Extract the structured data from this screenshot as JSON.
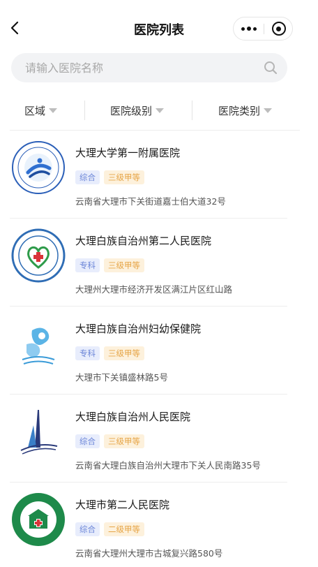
{
  "header": {
    "title": "医院列表",
    "back_icon": "chevron-left-icon",
    "more_icon": "more-dots-icon",
    "close_icon": "target-close-icon"
  },
  "search": {
    "placeholder": "请输入医院名称",
    "value": "",
    "icon": "search-icon"
  },
  "filters": [
    {
      "label": "区域"
    },
    {
      "label": "医院级别"
    },
    {
      "label": "医院类别"
    }
  ],
  "hospitals": [
    {
      "name": "大理大学第一附属医院",
      "type": "综合",
      "grade": "三级甲等",
      "address": "云南省大理市下关街道嘉士伯大道32号",
      "logo": "hospital-logo-icon"
    },
    {
      "name": "大理白族自治州第二人民医院",
      "type": "专科",
      "grade": "三级甲等",
      "address": "大理州大理市经济开发区满江片区红山路",
      "logo": "hospital-logo-icon"
    },
    {
      "name": "大理白族自治州妇幼保健院",
      "type": "专科",
      "grade": "三级甲等",
      "address": "大理市下关镇盛林路5号",
      "logo": "hospital-logo-icon"
    },
    {
      "name": "大理白族自治州人民医院",
      "type": "综合",
      "grade": "三级甲等",
      "address": "云南省大理白族自治州大理市下关人民南路35号",
      "logo": "hospital-logo-icon"
    },
    {
      "name": "大理市第二人民医院",
      "type": "综合",
      "grade": "二级甲等",
      "address": "云南省大理州大理市古城复兴路580号",
      "logo": "hospital-logo-icon"
    }
  ],
  "colors": {
    "type_tag_bg": "#e8edfc",
    "type_tag_text": "#6c86d8",
    "grade_tag_bg": "#fdf1dc",
    "grade_tag_text": "#e6a547"
  }
}
